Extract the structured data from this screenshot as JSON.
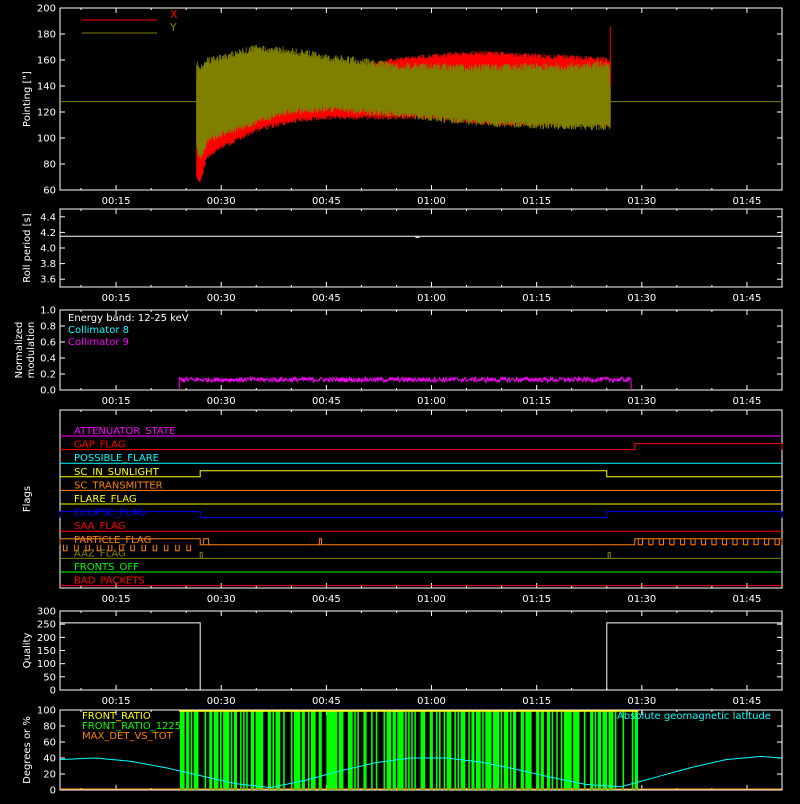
{
  "x_axis": {
    "ticks": [
      "00:15",
      "00:30",
      "00:45",
      "01:00",
      "01:15",
      "01:30",
      "01:45"
    ]
  },
  "colors": {
    "background": "#000000",
    "axes": "#ffffff",
    "x_series": "#ff0000",
    "y_series": "#808000",
    "collimator8": "#00ffff",
    "collimator9": "#ff00ff",
    "green": "#00ff00",
    "yellow": "#ffff00",
    "orange": "#ff8000",
    "cyan": "#00ffff"
  },
  "chart_data": [
    {
      "type": "line",
      "name": "pointing",
      "ylabel": "Pointing [\"]",
      "ylim": [
        60,
        200
      ],
      "yticks": [
        60,
        80,
        100,
        120,
        140,
        160,
        180,
        200
      ],
      "xlim": [
        "00:07",
        "01:50"
      ],
      "legend": [
        {
          "label": "X",
          "color": "#ff0000"
        },
        {
          "label": "Y",
          "color": "#808000"
        }
      ],
      "legend_position": "top-left",
      "series": [
        {
          "name": "X",
          "color": "#ff0000",
          "band": {
            "x": [
              "00:26.5",
              "00:27",
              "00:28",
              "00:30",
              "00:35",
              "00:40",
              "00:45",
              "00:50",
              "00:55",
              "01:00",
              "01:05",
              "01:10",
              "01:15",
              "01:20",
              "01:25.5"
            ],
            "upper": [
              145,
              140,
              142,
              145,
              150,
              150,
              150,
              155,
              160,
              163,
              165,
              165,
              163,
              162,
              160
            ],
            "lower": [
              72,
              68,
              88,
              95,
              108,
              115,
              118,
              118,
              118,
              118,
              115,
              113,
              113,
              115,
              113
            ]
          },
          "spike": {
            "x": "01:25.5",
            "y": 186
          }
        },
        {
          "name": "Y",
          "color": "#808000",
          "band": {
            "x": [
              "00:26.5",
              "00:27",
              "00:28",
              "00:30",
              "00:35",
              "00:40",
              "00:45",
              "00:50",
              "00:55",
              "01:00",
              "01:05",
              "01:10",
              "01:15",
              "01:20",
              "01:25.5"
            ],
            "upper": [
              160,
              158,
              162,
              165,
              172,
              170,
              165,
              162,
              158,
              158,
              157,
              157,
              158,
              158,
              160
            ],
            "lower": [
              88,
              82,
              95,
              100,
              110,
              118,
              120,
              118,
              116,
              113,
              110,
              108,
              107,
              106,
              106
            ]
          },
          "reference_level": 128
        }
      ]
    },
    {
      "type": "line",
      "name": "roll_period",
      "ylabel": "Roll period [s]",
      "ylim": [
        3.5,
        4.5
      ],
      "yticks": [
        3.6,
        3.8,
        4.0,
        4.2,
        4.4
      ],
      "series": [
        {
          "color": "#ffffff",
          "x": [
            "00:07",
            "01:50"
          ],
          "y": [
            4.15,
            4.15
          ]
        }
      ]
    },
    {
      "type": "line",
      "name": "modulation",
      "ylabel": "Normalized modulation",
      "ylim": [
        0.0,
        1.0
      ],
      "yticks": [
        0.0,
        0.2,
        0.4,
        0.6,
        0.8,
        1.0
      ],
      "legend": [
        {
          "label": "Energy band: 12-25 keV",
          "color": "#ffffff"
        },
        {
          "label": "Collimator 8",
          "color": "#00ffff"
        },
        {
          "label": "Collimator 9",
          "color": "#ff00ff"
        }
      ],
      "series": [
        {
          "name": "Collimator 9",
          "color": "#ff00ff",
          "x_range": [
            "00:24",
            "01:28.5"
          ],
          "y_mean": 0.13,
          "y_spread": 0.03
        }
      ]
    },
    {
      "type": "line",
      "name": "flags",
      "ylabel": "Flags",
      "flags": [
        {
          "label": "ATTENUATOR_STATE",
          "color": "#ff00ff",
          "segments": []
        },
        {
          "label": "GAP_FLAG",
          "color": "#ff0000",
          "segments": [
            [
              "01:29",
              "01:50"
            ]
          ]
        },
        {
          "label": "POSSIBLE_FLARE",
          "color": "#00ffff",
          "segments": []
        },
        {
          "label": "SC_IN_SUNLIGHT",
          "color": "#ffff00",
          "segments": [
            [
              "00:07",
              "00:27"
            ],
            [
              "01:25",
              "01:50"
            ]
          ],
          "inverted": true
        },
        {
          "label": "SC_TRANSMITTER",
          "color": "#ff8000",
          "segments": []
        },
        {
          "label": "FLARE_FLAG",
          "color": "#ffff00",
          "segments": []
        },
        {
          "label": "ECLIPSE_FLAG",
          "color": "#0000ff",
          "segments": [
            [
              "00:07",
              "00:27"
            ],
            [
              "01:25",
              "01:50"
            ]
          ]
        },
        {
          "label": "SAA_FLAG",
          "color": "#ff0000",
          "segments": []
        },
        {
          "label": "PARTICLE_FLAG",
          "color": "#ff8000",
          "segments": [
            [
              "00:07",
              "00:27"
            ],
            [
              "01:29",
              "01:50"
            ]
          ],
          "pulses": [
            [
              "00:27.5",
              "00:28.2"
            ],
            [
              "00:44",
              "00:44.3"
            ]
          ]
        },
        {
          "label": "AAZ_FLAG",
          "color": "#808000",
          "segments": [],
          "pulses": [
            [
              "00:27",
              "00:27.3"
            ],
            [
              "01:25.2",
              "01:25.5"
            ]
          ]
        },
        {
          "label": "FRONTS_OFF",
          "color": "#00ff00",
          "segments": []
        },
        {
          "label": "BAD_PACKETS",
          "color": "#ff0000",
          "segments": []
        }
      ]
    },
    {
      "type": "line",
      "name": "quality",
      "ylabel": "Quality",
      "ylim": [
        0,
        300
      ],
      "yticks": [
        0,
        50,
        100,
        150,
        200,
        250,
        300
      ],
      "series": [
        {
          "color": "#ffffff",
          "x": [
            "00:07",
            "00:27",
            "00:27",
            "01:25",
            "01:25",
            "01:50"
          ],
          "y": [
            255,
            255,
            0,
            0,
            255,
            255
          ]
        }
      ]
    },
    {
      "type": "line",
      "name": "ratios",
      "ylabel": "Degrees or %",
      "ylim": [
        0,
        100
      ],
      "yticks": [
        0,
        20,
        40,
        60,
        80,
        100
      ],
      "legend": [
        {
          "label": "FRONT_RATIO",
          "color": "#ffff00"
        },
        {
          "label": "FRONT_RATIO_1225",
          "color": "#00ff00"
        },
        {
          "label": "MAX_DET_VS_TOT",
          "color": "#ff8000"
        }
      ],
      "legend_right": {
        "label": "Absolute geomagnetic latitude",
        "color": "#00ffff"
      },
      "series": [
        {
          "name": "Absolute geomagnetic latitude",
          "color": "#00ffff",
          "x": [
            "00:07",
            "00:12",
            "00:17",
            "00:22",
            "00:27",
            "00:32",
            "00:37",
            "00:42",
            "00:47",
            "00:52",
            "00:57",
            "01:02",
            "01:07",
            "01:12",
            "01:17",
            "01:22",
            "01:27",
            "01:32",
            "01:37",
            "01:42",
            "01:47",
            "01:50"
          ],
          "y": [
            38,
            40,
            36,
            28,
            18,
            8,
            3,
            12,
            24,
            34,
            40,
            40,
            35,
            26,
            16,
            7,
            4,
            16,
            28,
            38,
            42,
            40
          ]
        },
        {
          "name": "FRONT_RATIO_1225",
          "color": "#00ff00",
          "x_range": [
            "00:24",
            "01:29.5"
          ],
          "bars": true
        }
      ]
    }
  ]
}
